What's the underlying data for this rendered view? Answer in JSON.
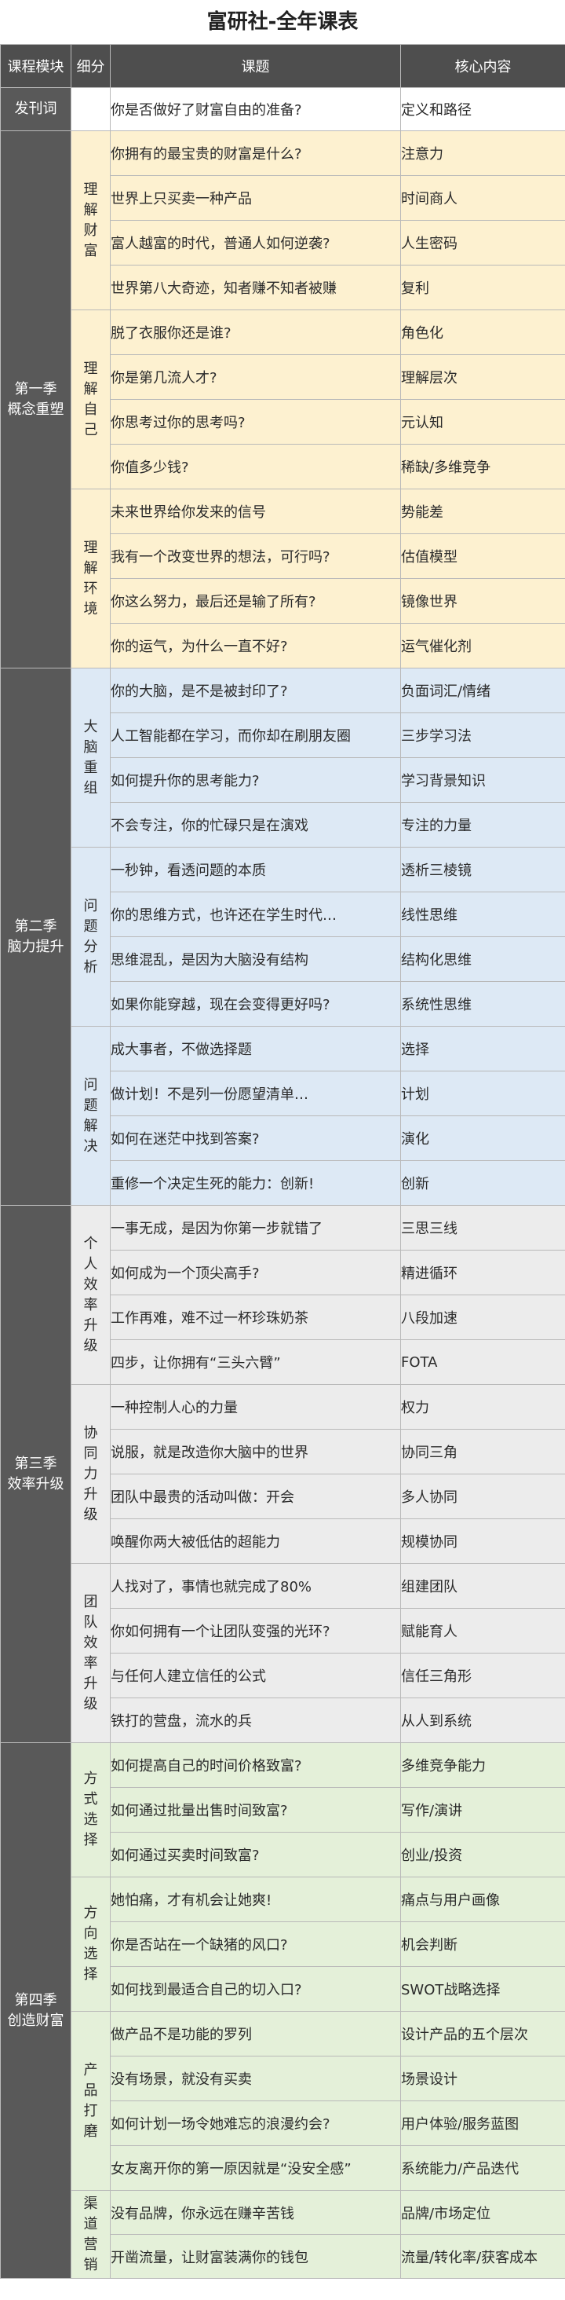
{
  "title": "富研社-全年课表",
  "headers": {
    "module": "课程模块",
    "sub": "细分",
    "topic": "课题",
    "core": "核心内容"
  },
  "intro": {
    "module": "发刊词",
    "topic": "你是否做好了财富自由的准备?",
    "core": "定义和路径"
  },
  "seasons": [
    {
      "module": "第一季\n概念重塑",
      "groups": [
        {
          "sub": "理解财富",
          "rows": [
            {
              "topic": "你拥有的最宝贵的财富是什么?",
              "core": "注意力"
            },
            {
              "topic": "世界上只买卖一种产品",
              "core": "时间商人"
            },
            {
              "topic": "富人越富的时代，普通人如何逆袭?",
              "core": "人生密码"
            },
            {
              "topic": "世界第八大奇迹，知者赚不知者被赚",
              "core": "复利"
            }
          ]
        },
        {
          "sub": "理解自己",
          "rows": [
            {
              "topic": "脱了衣服你还是谁?",
              "core": "角色化"
            },
            {
              "topic": "你是第几流人才?",
              "core": "理解层次"
            },
            {
              "topic": "你思考过你的思考吗?",
              "core": "元认知"
            },
            {
              "topic": "你值多少钱?",
              "core": "稀缺/多维竞争"
            }
          ]
        },
        {
          "sub": "理解环境",
          "rows": [
            {
              "topic": "未来世界给你发来的信号",
              "core": "势能差"
            },
            {
              "topic": "我有一个改变世界的想法，可行吗?",
              "core": "估值模型"
            },
            {
              "topic": "你这么努力，最后还是输了所有?",
              "core": "镜像世界"
            },
            {
              "topic": "你的运气，为什么一直不好?",
              "core": "运气催化剂"
            }
          ]
        }
      ]
    },
    {
      "module": "第二季\n脑力提升",
      "groups": [
        {
          "sub": "大脑重组",
          "rows": [
            {
              "topic": "你的大脑，是不是被封印了?",
              "core": "负面词汇/情绪"
            },
            {
              "topic": "人工智能都在学习，而你却在刷朋友圈",
              "core": "三步学习法"
            },
            {
              "topic": "如何提升你的思考能力?",
              "core": "学习背景知识"
            },
            {
              "topic": "不会专注，你的忙碌只是在演戏",
              "core": "专注的力量"
            }
          ]
        },
        {
          "sub": "问题分析",
          "rows": [
            {
              "topic": "一秒钟，看透问题的本质",
              "core": "透析三棱镜"
            },
            {
              "topic": "你的思维方式，也许还在学生时代…",
              "core": "线性思维"
            },
            {
              "topic": "思维混乱，是因为大脑没有结构",
              "core": "结构化思维"
            },
            {
              "topic": "如果你能穿越，现在会变得更好吗?",
              "core": "系统性思维"
            }
          ]
        },
        {
          "sub": "问题解决",
          "rows": [
            {
              "topic": "成大事者，不做选择题",
              "core": "选择"
            },
            {
              "topic": "做计划！不是列一份愿望清单…",
              "core": "计划"
            },
            {
              "topic": "如何在迷茫中找到答案?",
              "core": "演化"
            },
            {
              "topic": "重修一个决定生死的能力：创新!",
              "core": "创新"
            }
          ]
        }
      ]
    },
    {
      "module": "第三季\n效率升级",
      "groups": [
        {
          "sub": "个人效率升级",
          "rows": [
            {
              "topic": "一事无成，是因为你第一步就错了",
              "core": "三思三线"
            },
            {
              "topic": "如何成为一个顶尖高手?",
              "core": "精进循环"
            },
            {
              "topic": "工作再难，难不过一杯珍珠奶茶",
              "core": "八段加速"
            },
            {
              "topic": "四步，让你拥有“三头六臂”",
              "core": "FOTA"
            }
          ]
        },
        {
          "sub": "协同力升级",
          "rows": [
            {
              "topic": "一种控制人心的力量",
              "core": "权力"
            },
            {
              "topic": "说服，就是改造你大脑中的世界",
              "core": "协同三角"
            },
            {
              "topic": "团队中最贵的活动叫做：开会",
              "core": "多人协同"
            },
            {
              "topic": "唤醒你两大被低估的超能力",
              "core": "规模协同"
            }
          ]
        },
        {
          "sub": "团队效率升级",
          "rows": [
            {
              "topic": "人找对了，事情也就完成了80%",
              "core": "组建团队"
            },
            {
              "topic": "你如何拥有一个让团队变强的光环?",
              "core": "赋能育人"
            },
            {
              "topic": "与任何人建立信任的公式",
              "core": "信任三角形"
            },
            {
              "topic": "铁打的营盘，流水的兵",
              "core": "从人到系统"
            }
          ]
        }
      ]
    },
    {
      "module": "第四季\n创造财富",
      "groups": [
        {
          "sub": "方式选择",
          "rows": [
            {
              "topic": "如何提高自己的时间价格致富?",
              "core": "多维竞争能力"
            },
            {
              "topic": "如何通过批量出售时间致富?",
              "core": "写作/演讲"
            },
            {
              "topic": "如何通过买卖时间致富?",
              "core": "创业/投资"
            }
          ]
        },
        {
          "sub": "方向选择",
          "rows": [
            {
              "topic": "她怕痛，才有机会让她爽!",
              "core": "痛点与用户画像"
            },
            {
              "topic": "你是否站在一个缺猪的风口?",
              "core": "机会判断"
            },
            {
              "topic": "如何找到最适合自己的切入口?",
              "core": "SWOT战略选择"
            }
          ]
        },
        {
          "sub": "产品打磨",
          "rows": [
            {
              "topic": "做产品不是功能的罗列",
              "core": "设计产品的五个层次"
            },
            {
              "topic": "没有场景，就没有买卖",
              "core": "场景设计"
            },
            {
              "topic": "如何计划一场令她难忘的浪漫约会?",
              "core": "用户体验/服务蓝图"
            },
            {
              "topic": "女友离开你的第一原因就是“没安全感”",
              "core": "系统能力/产品迭代"
            }
          ]
        },
        {
          "sub": "渠道营销",
          "rows": [
            {
              "topic": "没有品牌，你永远在赚辛苦钱",
              "core": "品牌/市场定位"
            },
            {
              "topic": "开凿流量，让财富装满你的钱包",
              "core": "流量/转化率/获客成本"
            }
          ]
        }
      ]
    }
  ]
}
